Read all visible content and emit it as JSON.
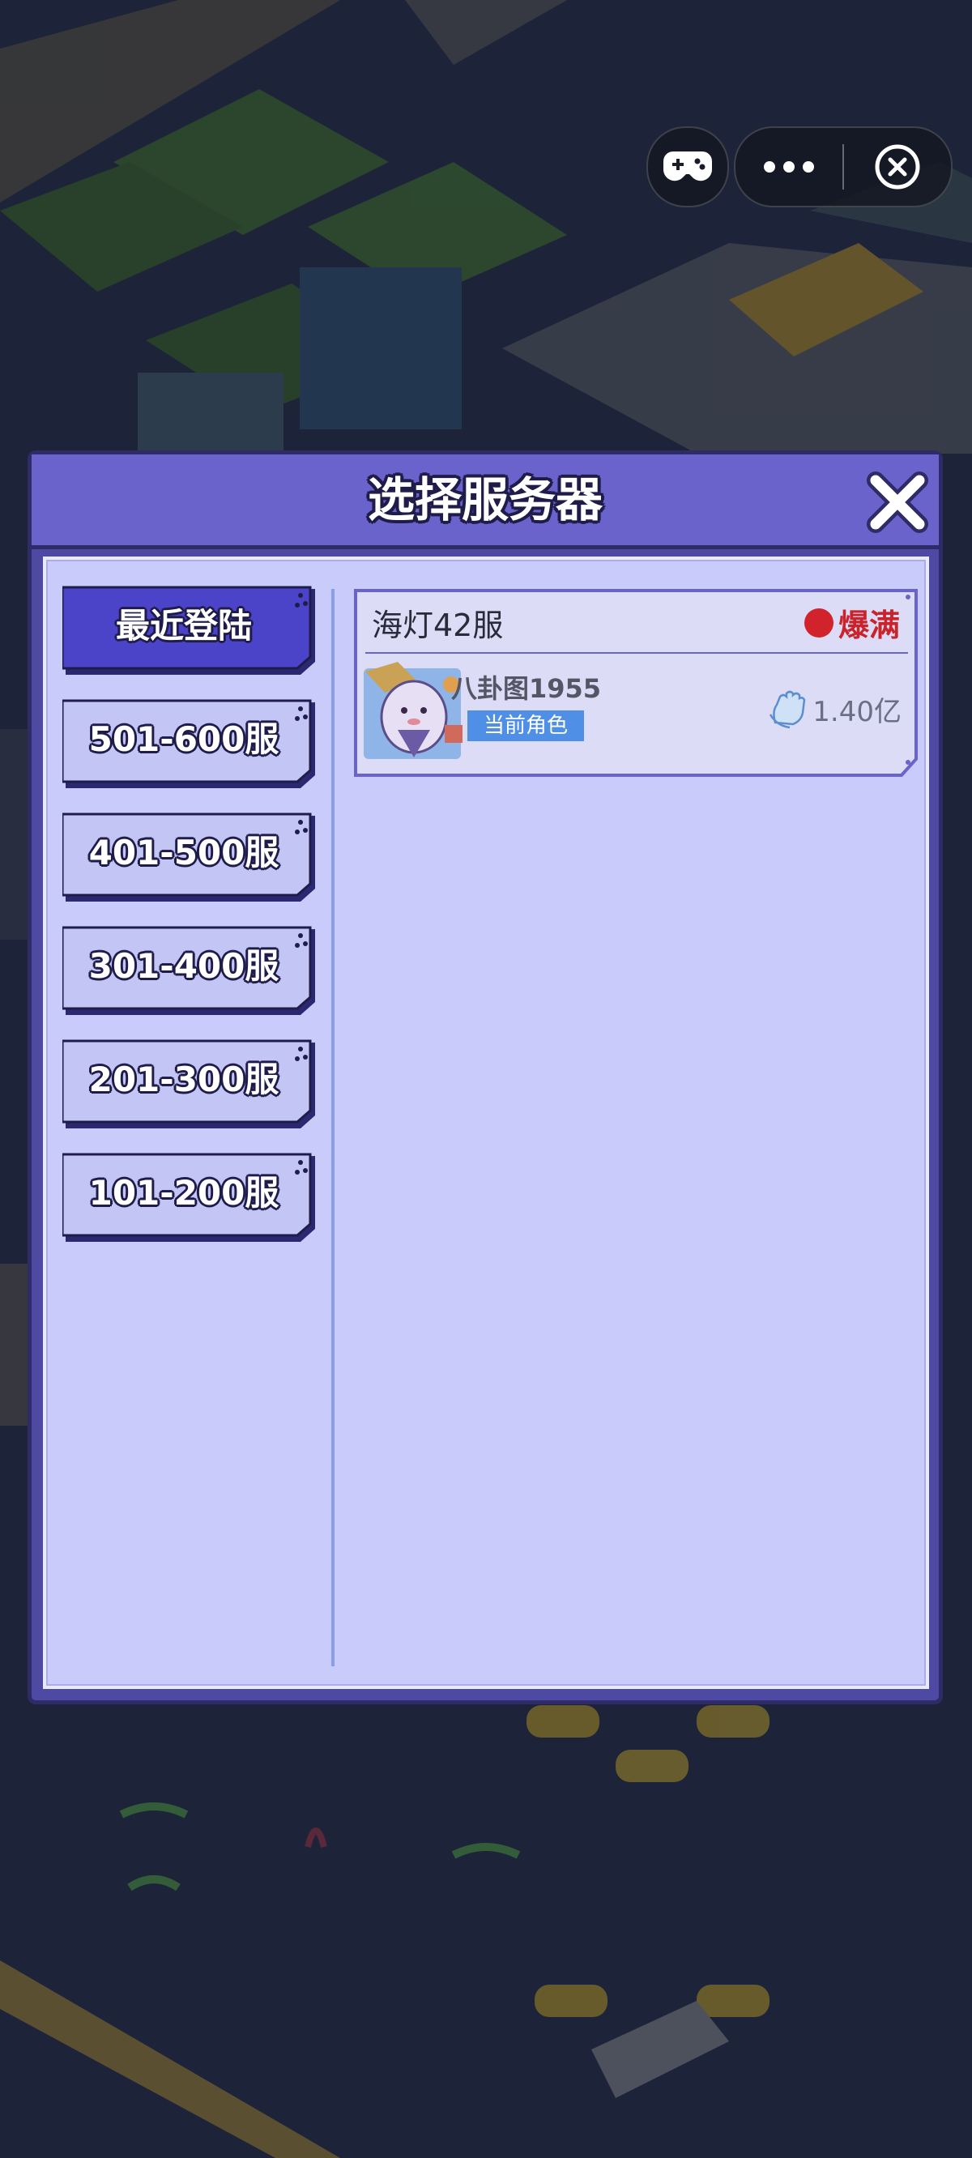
{
  "top_bar": {
    "game_icon": "gamepad-icon",
    "more_icon": "more-dots-icon",
    "close_icon": "close-circle-icon"
  },
  "dialog": {
    "title": "选择服务器",
    "close_icon": "close-x-icon"
  },
  "tabs": [
    {
      "label": "最近登陆",
      "active": true
    },
    {
      "label": "501-600服",
      "active": false
    },
    {
      "label": "401-500服",
      "active": false
    },
    {
      "label": "301-400服",
      "active": false
    },
    {
      "label": "201-300服",
      "active": false
    },
    {
      "label": "101-200服",
      "active": false
    }
  ],
  "servers": [
    {
      "name": "海灯42服",
      "status": "爆满",
      "status_color": "#d0232b",
      "role_name": "八卦图1955",
      "role_badge": "当前角色",
      "power": "1.40亿",
      "power_icon": "fist-power-icon",
      "avatar_icon": "character-avatar-icon"
    }
  ],
  "colors": {
    "header": "#6a63cc",
    "panel": "#c9ccfb",
    "active_tab": "#4b44c9",
    "inactive_tab": "#c3c6f5",
    "badge": "#4f8fe6"
  }
}
